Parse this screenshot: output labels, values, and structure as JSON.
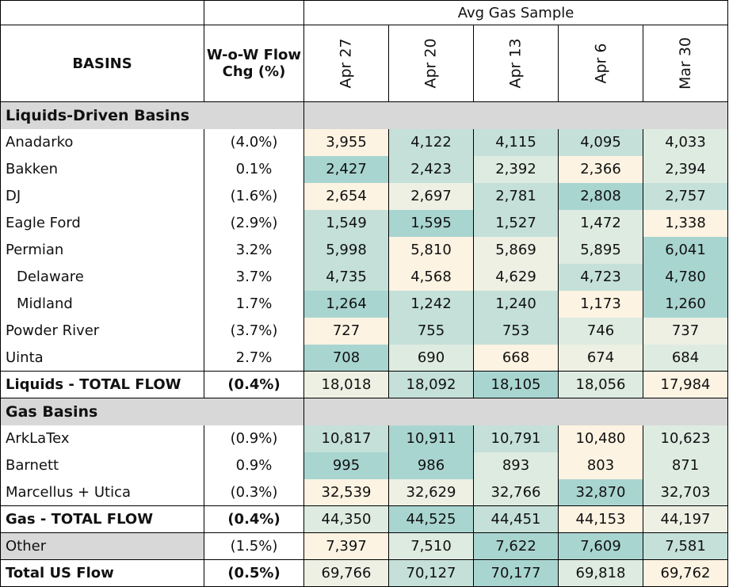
{
  "header": {
    "group_label": "Avg Gas Sample",
    "basins_label": "BASINS",
    "chg_label_line1": "W-o-W Flow",
    "chg_label_line2": "Chg (%)",
    "weeks": [
      "Apr 27",
      "Apr 20",
      "Apr 13",
      "Apr 6",
      "Mar 30"
    ]
  },
  "sections": {
    "liquids": "Liquids-Driven Basins",
    "gas": "Gas Basins"
  },
  "rows": [
    {
      "name": "Anadarko",
      "chg": "(4.0%)",
      "values": [
        "3,955",
        "4,122",
        "4,115",
        "4,095",
        "4,033"
      ],
      "shades": [
        5,
        2,
        2,
        2,
        3
      ]
    },
    {
      "name": "Bakken",
      "chg": "0.1%",
      "values": [
        "2,427",
        "2,423",
        "2,392",
        "2,366",
        "2,394"
      ],
      "shades": [
        1,
        2,
        3,
        5,
        3
      ]
    },
    {
      "name": "DJ",
      "chg": "(1.6%)",
      "values": [
        "2,654",
        "2,697",
        "2,781",
        "2,808",
        "2,757"
      ],
      "shades": [
        5,
        4,
        2,
        1,
        2
      ]
    },
    {
      "name": "Eagle Ford",
      "chg": "(2.9%)",
      "values": [
        "1,549",
        "1,595",
        "1,527",
        "1,472",
        "1,338"
      ],
      "shades": [
        2,
        1,
        2,
        3,
        5
      ]
    },
    {
      "name": "Permian",
      "chg": "3.2%",
      "values": [
        "5,998",
        "5,810",
        "5,869",
        "5,895",
        "6,041"
      ],
      "shades": [
        2,
        5,
        4,
        3,
        1
      ]
    },
    {
      "name": "Delaware",
      "chg": "3.7%",
      "values": [
        "4,735",
        "4,568",
        "4,629",
        "4,723",
        "4,780"
      ],
      "shades": [
        2,
        5,
        4,
        2,
        1
      ],
      "sub": true
    },
    {
      "name": "Midland",
      "chg": "1.7%",
      "values": [
        "1,264",
        "1,242",
        "1,240",
        "1,173",
        "1,260"
      ],
      "shades": [
        1,
        2,
        2,
        5,
        1
      ],
      "sub": true
    },
    {
      "name": "Powder River",
      "chg": "(3.7%)",
      "values": [
        "727",
        "755",
        "753",
        "746",
        "737"
      ],
      "shades": [
        5,
        2,
        2,
        3,
        4
      ]
    },
    {
      "name": "Uinta",
      "chg": "2.7%",
      "values": [
        "708",
        "690",
        "668",
        "674",
        "684"
      ],
      "shades": [
        1,
        3,
        5,
        4,
        3
      ]
    }
  ],
  "liquids_total": {
    "name": "Liquids - TOTAL FLOW",
    "chg": "(0.4%)",
    "values": [
      "18,018",
      "18,092",
      "18,105",
      "18,056",
      "17,984"
    ],
    "shades": [
      4,
      2,
      1,
      3,
      5
    ]
  },
  "gas_rows": [
    {
      "name": "ArkLaTex",
      "chg": "(0.9%)",
      "values": [
        "10,817",
        "10,911",
        "10,791",
        "10,480",
        "10,623"
      ],
      "shades": [
        2,
        1,
        2,
        5,
        3
      ]
    },
    {
      "name": "Barnett",
      "chg": "0.9%",
      "values": [
        "995",
        "986",
        "893",
        "803",
        "871"
      ],
      "shades": [
        1,
        1,
        3,
        5,
        3
      ]
    },
    {
      "name": "Marcellus + Utica",
      "chg": "(0.3%)",
      "values": [
        "32,539",
        "32,629",
        "32,766",
        "32,870",
        "32,703"
      ],
      "shades": [
        5,
        4,
        3,
        1,
        3
      ]
    }
  ],
  "gas_total": {
    "name": "Gas - TOTAL FLOW",
    "chg": "(0.4%)",
    "values": [
      "44,350",
      "44,525",
      "44,451",
      "44,153",
      "44,197"
    ],
    "shades": [
      3,
      1,
      2,
      5,
      4
    ]
  },
  "other": {
    "name": "Other",
    "chg": "(1.5%)",
    "values": [
      "7,397",
      "7,510",
      "7,622",
      "7,609",
      "7,581"
    ],
    "shades": [
      5,
      3,
      1,
      1,
      2
    ]
  },
  "total_us": {
    "name": "Total US Flow",
    "chg": "(0.5%)",
    "values": [
      "69,766",
      "70,127",
      "70,177",
      "69,818",
      "69,762"
    ],
    "shades": [
      4,
      2,
      1,
      3,
      5
    ]
  }
}
